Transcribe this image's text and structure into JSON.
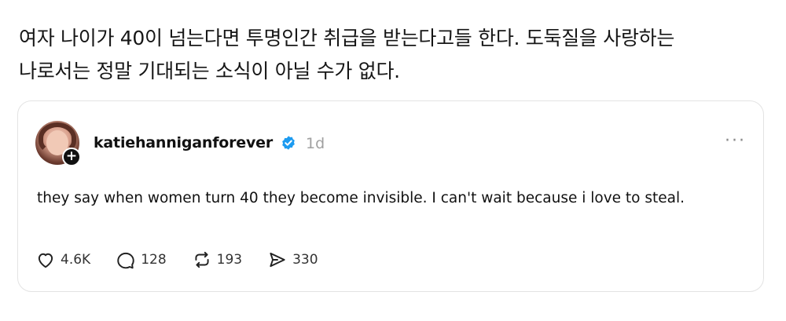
{
  "caption": {
    "line1": "여자 나이가 40이 넘는다면 투명인간 취급을 받는다고들 한다. 도둑질을 사랑하는",
    "line2": "나로서는 정말 기대되는 소식이 아닐 수가 없다."
  },
  "post": {
    "username": "katiehanniganforever",
    "time": "1d",
    "text": "they say when women turn 40 they become invisible. I can't wait because i love to steal.",
    "more_label": "···",
    "follow_label": "+",
    "actions": {
      "likes": "4.6K",
      "replies": "128",
      "reposts": "193",
      "shares": "330"
    },
    "icons": {
      "like": "heart-icon",
      "reply": "speech-bubble-icon",
      "repost": "repost-icon",
      "share": "send-icon",
      "verified": "verified-badge-icon"
    },
    "colors": {
      "verified": "#1d9bf0",
      "text": "#111111",
      "muted": "#a0a0a0"
    }
  }
}
